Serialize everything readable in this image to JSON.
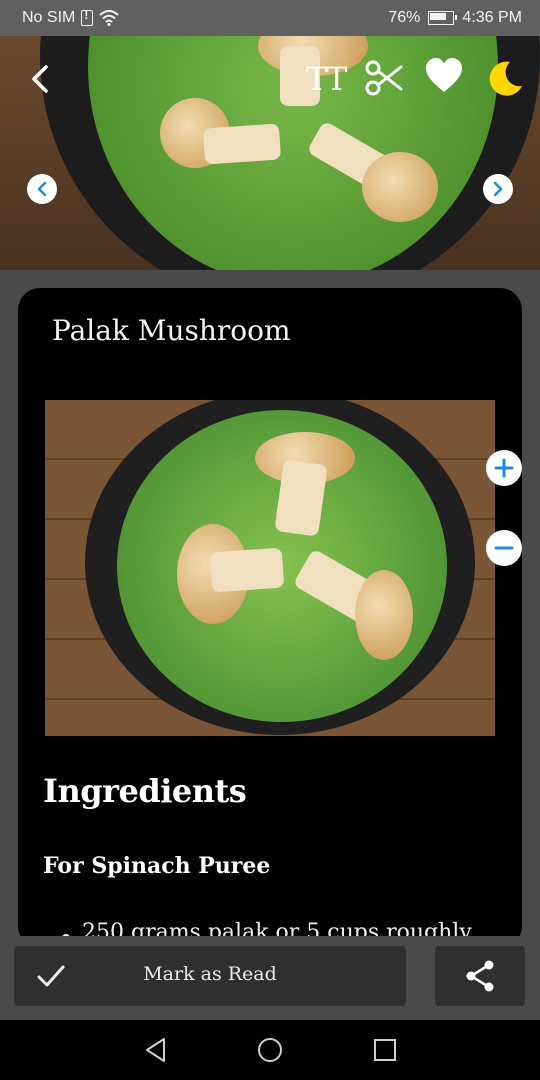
{
  "status_bar": {
    "carrier": "No SIM",
    "battery": "76%",
    "time": "4:36 PM"
  },
  "hero": {
    "icons": [
      "back-icon",
      "text-size-icon",
      "scissors-icon",
      "heart-icon",
      "moon-icon",
      "chevron-left-icon",
      "chevron-right-icon"
    ],
    "text_size_glyph": "TT"
  },
  "recipe": {
    "title": "Palak Mushroom",
    "ingredients_heading": "Ingredients",
    "section_heading": "For Spinach Puree",
    "items": [
      "250 grams palak or 5 cups roughly"
    ]
  },
  "actions": {
    "mark_read_label": "Mark as Read"
  },
  "colors": {
    "accent_blue": "#1e88e5",
    "moon_yellow": "#ffd600",
    "card_bg": "#000000",
    "button_bg": "#2f2f2f"
  }
}
